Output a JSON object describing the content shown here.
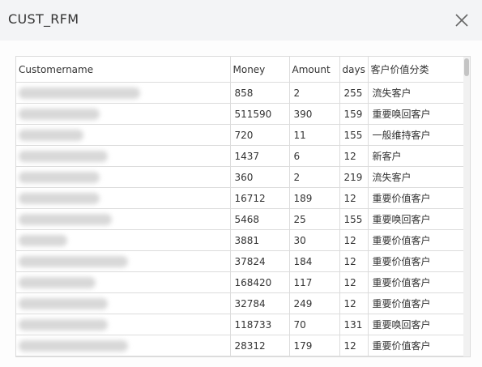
{
  "dialog": {
    "title": "CUST_RFM"
  },
  "table": {
    "headers": [
      "Customername",
      "Money",
      "Amount",
      "days",
      "客户价值分类"
    ],
    "rows": [
      {
        "money": "858",
        "amount": "2",
        "days": "255",
        "category": "流失客户"
      },
      {
        "money": "511590",
        "amount": "390",
        "days": "159",
        "category": "重要唤回客户"
      },
      {
        "money": "720",
        "amount": "11",
        "days": "155",
        "category": "一般维持客户"
      },
      {
        "money": "1437",
        "amount": "6",
        "days": "12",
        "category": "新客户"
      },
      {
        "money": "360",
        "amount": "2",
        "days": "219",
        "category": "流失客户"
      },
      {
        "money": "16712",
        "amount": "189",
        "days": "12",
        "category": "重要价值客户"
      },
      {
        "money": "5468",
        "amount": "25",
        "days": "155",
        "category": "重要唤回客户"
      },
      {
        "money": "3881",
        "amount": "30",
        "days": "12",
        "category": "重要价值客户"
      },
      {
        "money": "37824",
        "amount": "184",
        "days": "12",
        "category": "重要价值客户"
      },
      {
        "money": "168420",
        "amount": "117",
        "days": "12",
        "category": "重要价值客户"
      },
      {
        "money": "32784",
        "amount": "249",
        "days": "12",
        "category": "重要价值客户"
      },
      {
        "money": "118733",
        "amount": "70",
        "days": "131",
        "category": "重要唤回客户"
      },
      {
        "money": "28312",
        "amount": "179",
        "days": "12",
        "category": "重要价值客户"
      }
    ]
  },
  "icons": {
    "close": "close-icon"
  },
  "colors": {
    "header_bg": "#f3f4f6",
    "border": "#dcdcdc",
    "text": "#333333",
    "blur": "#d8d8d8"
  }
}
